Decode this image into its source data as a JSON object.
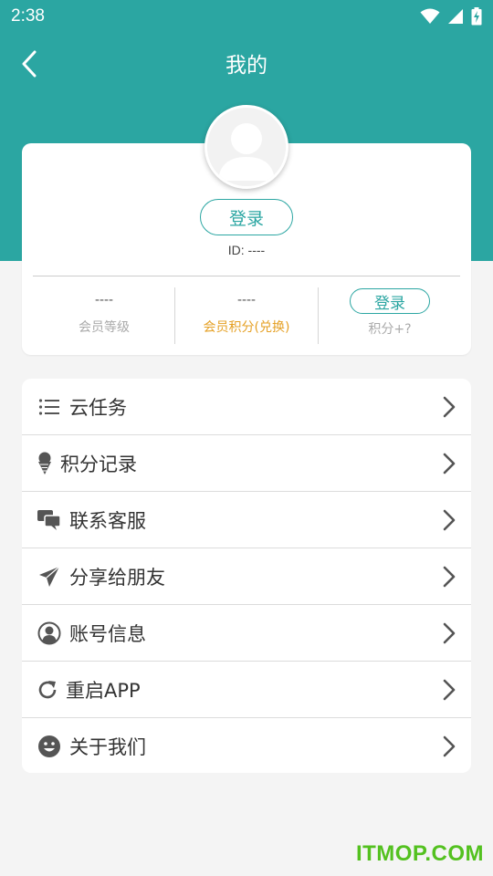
{
  "status_bar": {
    "time": "2:38"
  },
  "nav": {
    "title": "我的"
  },
  "profile": {
    "login_label": "登录",
    "id_text": "ID: ----"
  },
  "stats": [
    {
      "value": "----",
      "label": "会员等级"
    },
    {
      "value": "----",
      "label": "会员积分(兑换)"
    },
    {
      "button": "登录",
      "label": "积分+?"
    }
  ],
  "menu": [
    {
      "label": "云任务",
      "icon": "list-icon"
    },
    {
      "label": "积分记录",
      "icon": "ice-cream-icon"
    },
    {
      "label": "联系客服",
      "icon": "chat-bubbles-icon"
    },
    {
      "label": "分享给朋友",
      "icon": "paper-plane-icon"
    },
    {
      "label": "账号信息",
      "icon": "user-circle-icon"
    },
    {
      "label": "重启APP",
      "icon": "refresh-icon"
    },
    {
      "label": "关于我们",
      "icon": "smile-icon"
    }
  ],
  "watermark": "ITMOP.COM",
  "colors": {
    "primary": "#2ba6a2",
    "accent_orange": "#e5a024",
    "watermark": "#53c11f"
  }
}
